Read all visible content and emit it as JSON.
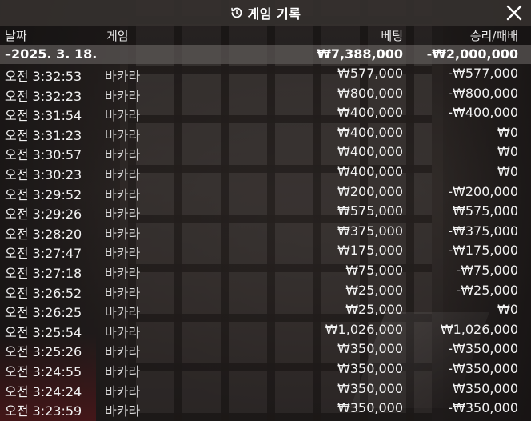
{
  "header": {
    "title": "게임 기록",
    "history_icon": "history-clock-icon",
    "close_icon": "close-icon"
  },
  "columns": {
    "date": "날짜",
    "game": "게임",
    "bet": "베팅",
    "win_loss": "승리/패배"
  },
  "summary": {
    "date": "–2025. 3. 18.",
    "bet": "₩7,388,000",
    "win_loss": "-₩2,000,000"
  },
  "rows": [
    {
      "time": "오전 3:32:53",
      "game": "바카라",
      "bet": "₩577,000",
      "result": "-₩577,000"
    },
    {
      "time": "오전 3:32:23",
      "game": "바카라",
      "bet": "₩800,000",
      "result": "-₩800,000"
    },
    {
      "time": "오전 3:31:54",
      "game": "바카라",
      "bet": "₩400,000",
      "result": "-₩400,000"
    },
    {
      "time": "오전 3:31:23",
      "game": "바카라",
      "bet": "₩400,000",
      "result": "₩0"
    },
    {
      "time": "오전 3:30:57",
      "game": "바카라",
      "bet": "₩400,000",
      "result": "₩0"
    },
    {
      "time": "오전 3:30:23",
      "game": "바카라",
      "bet": "₩400,000",
      "result": "₩0"
    },
    {
      "time": "오전 3:29:52",
      "game": "바카라",
      "bet": "₩200,000",
      "result": "-₩200,000"
    },
    {
      "time": "오전 3:29:26",
      "game": "바카라",
      "bet": "₩575,000",
      "result": "₩575,000"
    },
    {
      "time": "오전 3:28:20",
      "game": "바카라",
      "bet": "₩375,000",
      "result": "-₩375,000"
    },
    {
      "time": "오전 3:27:47",
      "game": "바카라",
      "bet": "₩175,000",
      "result": "-₩175,000"
    },
    {
      "time": "오전 3:27:18",
      "game": "바카라",
      "bet": "₩75,000",
      "result": "-₩75,000"
    },
    {
      "time": "오전 3:26:52",
      "game": "바카라",
      "bet": "₩25,000",
      "result": "-₩25,000"
    },
    {
      "time": "오전 3:26:25",
      "game": "바카라",
      "bet": "₩25,000",
      "result": "₩0"
    },
    {
      "time": "오전 3:25:54",
      "game": "바카라",
      "bet": "₩1,026,000",
      "result": "₩1,026,000"
    },
    {
      "time": "오전 3:25:26",
      "game": "바카라",
      "bet": "₩350,000",
      "result": "-₩350,000"
    },
    {
      "time": "오전 3:24:55",
      "game": "바카라",
      "bet": "₩350,000",
      "result": "-₩350,000"
    },
    {
      "time": "오전 3:24:24",
      "game": "바카라",
      "bet": "₩350,000",
      "result": "₩350,000"
    },
    {
      "time": "오전 3:23:59",
      "game": "바카라",
      "bet": "₩350,000",
      "result": "-₩350,000"
    }
  ]
}
